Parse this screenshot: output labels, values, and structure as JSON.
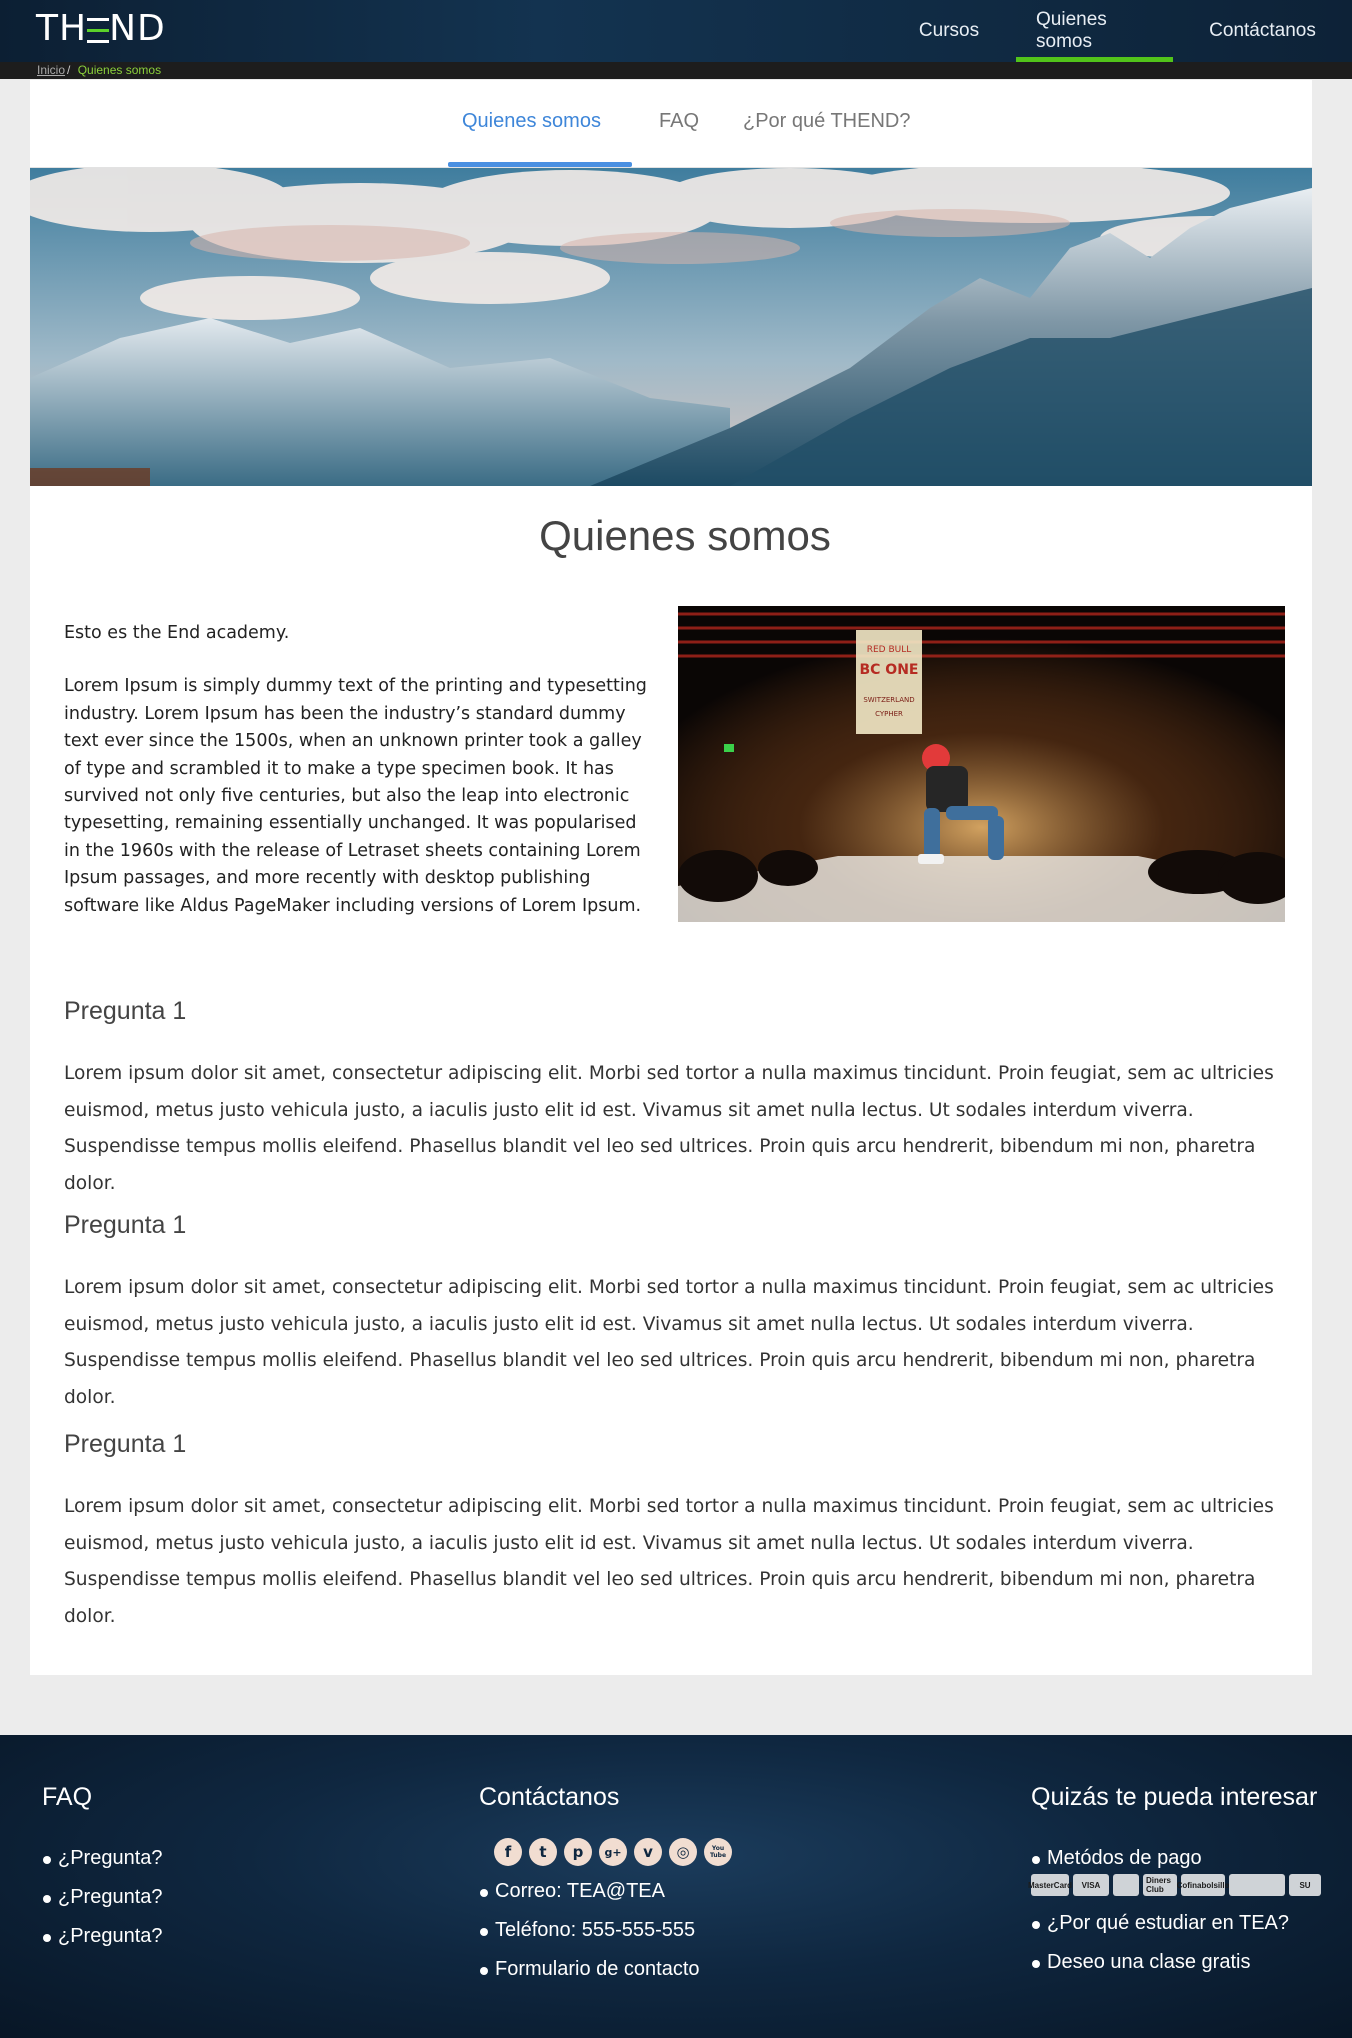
{
  "header": {
    "logo_left": "TH",
    "logo_right": "ND",
    "nav": [
      "Cursos",
      "Quienes somos",
      "Contáctanos"
    ],
    "active_nav": "Quienes somos",
    "accent": "#52c41a"
  },
  "breadcrumb": {
    "home": "Inicio",
    "separator": "/",
    "current": "Quienes somos"
  },
  "tabs": {
    "items": [
      "Quienes somos",
      "FAQ",
      "¿Por qué THEND?"
    ],
    "active": "Quienes somos",
    "active_color": "#4a90e2"
  },
  "main": {
    "title": "Quienes somos",
    "intro_heading": "Esto es the End academy.",
    "intro_body": "Lorem Ipsum is simply dummy text of the printing and typesetting industry. Lorem Ipsum has been the industry’s standard dummy text ever since the 1500s, when an unknown printer took a galley of type and scrambled it to make a type specimen book. It has survived not only five centuries, but also the leap into electronic typesetting, remaining essentially unchanged. It was popularised in the 1960s with the release of Letraset sheets containing Lorem Ipsum passages, and more recently with desktop publishing software like Aldus PageMaker including versions of Lorem Ipsum.",
    "photo_banner_lines": [
      "RED BULL",
      "BC ONE",
      "SWITZERLAND",
      "CYPHER"
    ],
    "faq": [
      {
        "question": "Pregunta 1",
        "answer": "Lorem ipsum dolor sit amet, consectetur adipiscing elit. Morbi sed tortor a nulla maximus tincidunt. Proin feugiat, sem ac ultricies euismod, metus justo vehicula justo, a iaculis justo elit id est. Vivamus sit amet nulla lectus. Ut sodales interdum viverra. Suspendisse tempus mollis eleifend. Phasellus blandit vel leo sed ultrices. Proin quis arcu hendrerit, bibendum mi non, pharetra dolor."
      },
      {
        "question": "Pregunta 1",
        "answer": "Lorem ipsum dolor sit amet, consectetur adipiscing elit. Morbi sed tortor a nulla maximus tincidunt. Proin feugiat, sem ac ultricies euismod, metus justo vehicula justo, a iaculis justo elit id est. Vivamus sit amet nulla lectus. Ut sodales interdum viverra. Suspendisse tempus mollis eleifend. Phasellus blandit vel leo sed ultrices. Proin quis arcu hendrerit, bibendum mi non, pharetra dolor."
      },
      {
        "question": "Pregunta 1",
        "answer": "Lorem ipsum dolor sit amet, consectetur adipiscing elit. Morbi sed tortor a nulla maximus tincidunt. Proin feugiat, sem ac ultricies euismod, metus justo vehicula justo, a iaculis justo elit id est. Vivamus sit amet nulla lectus. Ut sodales interdum viverra. Suspendisse tempus mollis eleifend. Phasellus blandit vel leo sed ultrices. Proin quis arcu hendrerit, bibendum mi non, pharetra dolor."
      }
    ]
  },
  "footer": {
    "faq": {
      "title": "FAQ",
      "items": [
        "¿Pregunta?",
        "¿Pregunta?",
        "¿Pregunta?"
      ]
    },
    "contact": {
      "title": "Contáctanos",
      "social": [
        {
          "icon": "facebook-icon",
          "glyph": "f"
        },
        {
          "icon": "twitter-icon",
          "glyph": "t"
        },
        {
          "icon": "pinterest-icon",
          "glyph": "p"
        },
        {
          "icon": "google-plus-icon",
          "glyph": "g+"
        },
        {
          "icon": "vimeo-icon",
          "glyph": "v"
        },
        {
          "icon": "instagram-icon",
          "glyph": "◎"
        },
        {
          "icon": "youtube-icon",
          "glyph": "You Tube"
        }
      ],
      "items": [
        "Correo: TEA@TEA",
        "Teléfono: 555-555-555",
        "Formulario de contacto"
      ]
    },
    "interest": {
      "title": "Quizás te pueda interesar",
      "payment_label": "Metódos de pago",
      "payment_methods": [
        "MasterCard",
        "VISA",
        "",
        "Diners Club",
        "Cofinabolsillo",
        "",
        "SU"
      ],
      "items": [
        "¿Por qué estudiar en TEA?",
        "Deseo una clase gratis"
      ]
    }
  }
}
